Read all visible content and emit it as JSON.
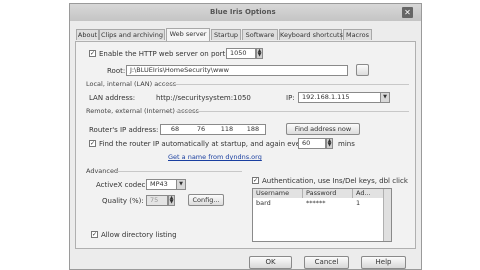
{
  "window": {
    "title": "Blue Iris Options",
    "close_glyph": "✕"
  },
  "tabs": [
    {
      "label": "About"
    },
    {
      "label": "Clips and archiving"
    },
    {
      "label": "Web server"
    },
    {
      "label": "Startup"
    },
    {
      "label": "Software"
    },
    {
      "label": "Keyboard shortcuts"
    },
    {
      "label": "Macros"
    }
  ],
  "web": {
    "enable_label": "Enable the HTTP web server on port",
    "enable_checked": "✓",
    "port": "1050",
    "root_label": "Root:",
    "root_value": "J:\\BLUEIris\\HomeSecurity\\www"
  },
  "lan": {
    "section_label": "Local, internal (LAN) access",
    "address_label": "LAN address:",
    "address_value": "http://securitysystem:1050",
    "ip_label": "IP:",
    "ip_value": "192.168.1.115"
  },
  "wan": {
    "section_label": "Remote, external (Internet) access",
    "router_label": "Router's IP address:",
    "ip_segments": [
      "68",
      "76",
      "118",
      "188"
    ],
    "find_button": "Find address now",
    "auto_find_label": "Find the router IP automatically at startup, and again every",
    "auto_find_checked": "✓",
    "interval": "60",
    "interval_unit": "mins",
    "link": "Get a name from dyndns.org"
  },
  "advanced": {
    "section_label": "Advanced",
    "activex_label": "ActiveX codec:",
    "activex_value": "MP43",
    "quality_label": "Quality (%):",
    "quality_value": "75",
    "config_button": "Config...",
    "allow_listing_label": "Allow directory listing",
    "allow_listing_checked": "✓"
  },
  "auth": {
    "label": "Authentication, use Ins/Del keys, dbl click",
    "checked": "✓",
    "columns": [
      "Username",
      "Password",
      "Ad..."
    ],
    "rows": [
      [
        "bard",
        "******",
        "1"
      ]
    ]
  },
  "buttons": {
    "ok": "OK",
    "cancel": "Cancel",
    "help": "Help"
  },
  "icons": {
    "spin_up": "▲",
    "spin_down": "▼",
    "dropdown": "▼"
  }
}
